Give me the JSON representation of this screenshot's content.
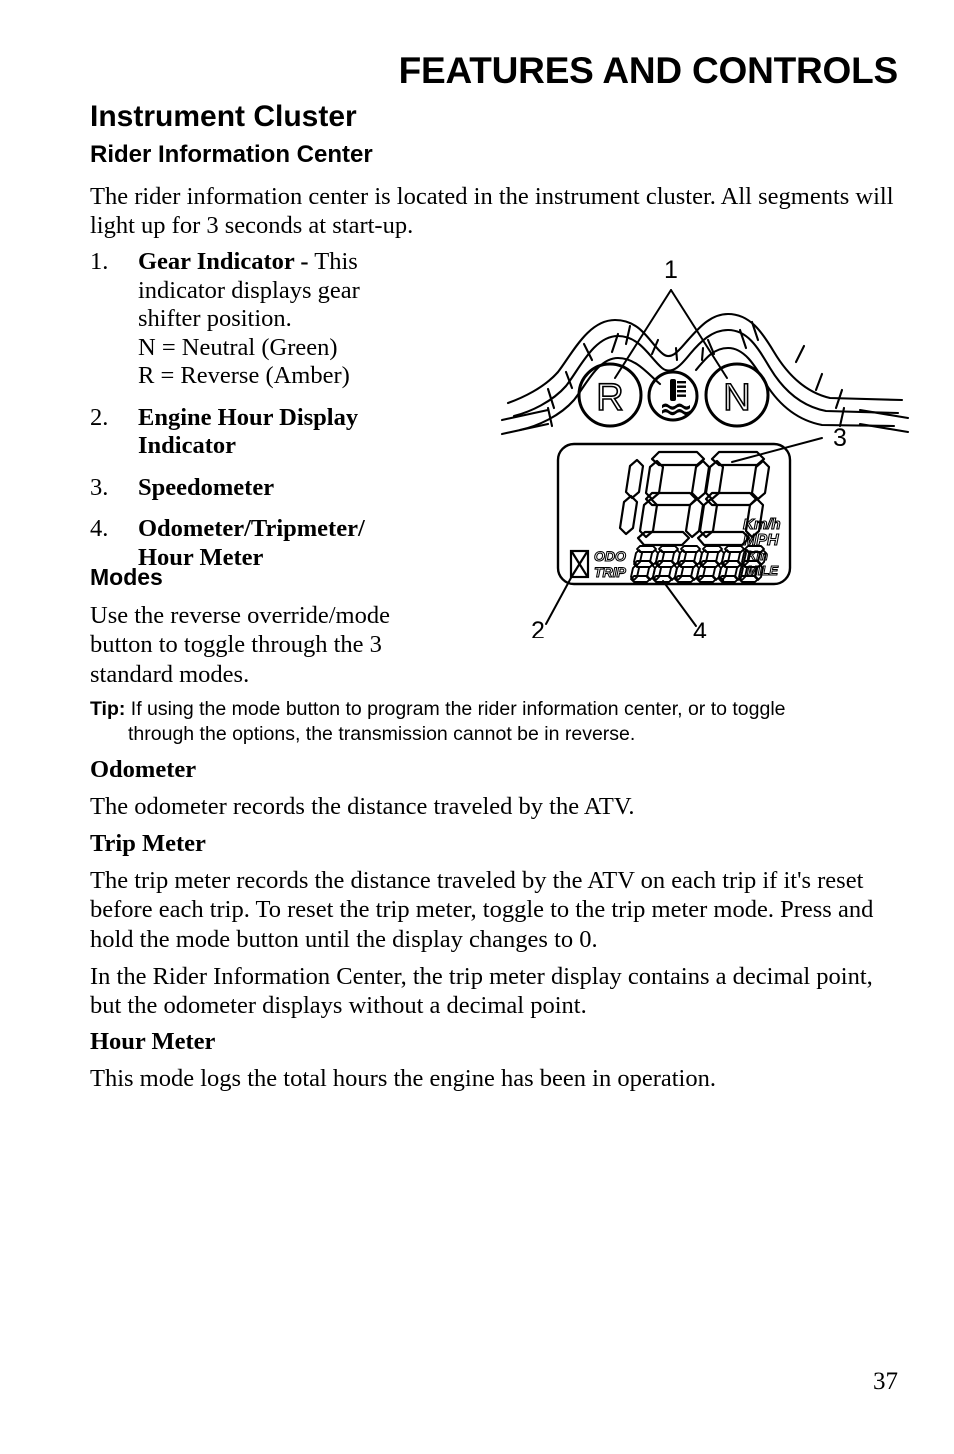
{
  "running_head": "FEATURES AND CONTROLS",
  "headings": {
    "h1": "Instrument Cluster",
    "h2": "Rider Information Center",
    "modes": "Modes"
  },
  "intro": "The rider information center is located in the instrument cluster. All segments will light up for 3 seconds at start-up.",
  "numbered_list": [
    {
      "num": "1.",
      "title": "Gear Indicator -",
      "text": " This indicator displays gear shifter position.",
      "line2": "N = Neutral (Green)",
      "line3": "R = Reverse (Amber)"
    },
    {
      "num": "2.",
      "title": "Engine Hour Display Indicator",
      "text": "",
      "line2": "",
      "line3": ""
    },
    {
      "num": "3.",
      "title": "Speedometer",
      "text": "",
      "line2": "",
      "line3": ""
    },
    {
      "num": "4.",
      "title": "Odometer/Tripmeter/ Hour Meter",
      "text": "",
      "line2": "",
      "line3": ""
    }
  ],
  "modes_paragraph": "Use the reverse override/mode button to toggle through the 3 standard modes.",
  "tip": {
    "label": "Tip:",
    "line1": " If using the mode button to program the rider information center, or to toggle",
    "line2": "through the options, the transmission cannot be in reverse."
  },
  "sections": [
    {
      "heading": "Odometer",
      "body": "The odometer records the distance traveled by the ATV."
    },
    {
      "heading": "Trip Meter",
      "body": "The trip meter records the distance traveled by the ATV on each trip if it's reset before each trip. To reset the trip meter, toggle to the trip meter mode. Press and hold the mode button until the display changes to 0."
    },
    {
      "heading": "",
      "body": "In the Rider Information Center, the trip meter display contains a decimal point, but the odometer displays without a decimal point."
    },
    {
      "heading": "Hour Meter",
      "body": "This mode logs the total hours the engine has been in operation."
    }
  ],
  "figure": {
    "callouts": {
      "one": "1",
      "two": "2",
      "three": "3",
      "four": "4"
    },
    "gear_indicators": {
      "reverse": "R",
      "neutral": "N"
    },
    "lcd": {
      "speed_digits": "188",
      "unit_kmh": "Km/h",
      "unit_mph": "MPH",
      "odo_label": "ODO",
      "trip_label": "TRIP",
      "odo_digits": "888888",
      "unit_km": "Km",
      "unit_mile": "MILE"
    }
  },
  "page_number": "37",
  "colors": {
    "ink": "#000000",
    "paper": "#ffffff"
  }
}
